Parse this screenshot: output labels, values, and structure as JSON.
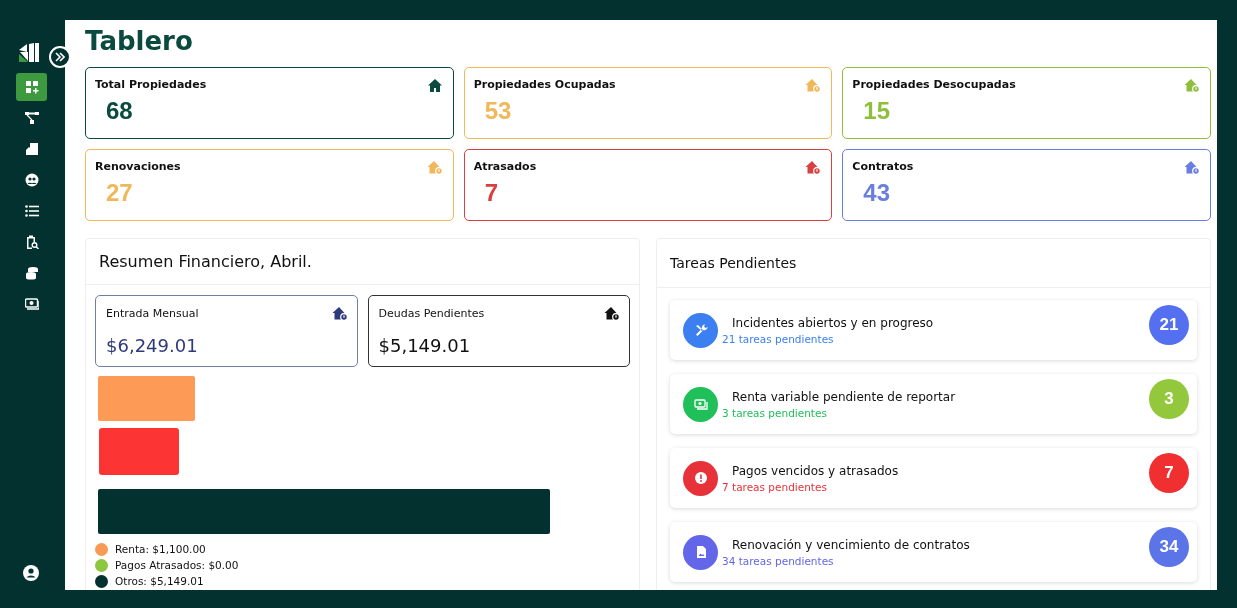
{
  "sidebar": {
    "items": [
      {
        "selected": true
      },
      {
        "selected": false
      },
      {
        "selected": false
      },
      {
        "selected": false
      },
      {
        "selected": false
      },
      {
        "selected": false
      },
      {
        "selected": false
      },
      {
        "selected": false
      }
    ]
  },
  "page_title": "Tablero",
  "stats": [
    {
      "label": "Total Propiedades",
      "value": "68",
      "color": "#0b4a3f",
      "kind": "house"
    },
    {
      "label": "Propiedades Ocupadas",
      "value": "53",
      "color": "#f0b85a",
      "kind": "house-badge"
    },
    {
      "label": "Propiedades Desocupadas",
      "value": "15",
      "color": "#8fbf3a",
      "kind": "house-badge"
    },
    {
      "label": "Renovaciones",
      "value": "27",
      "color": "#f0b85a",
      "kind": "house-badge"
    },
    {
      "label": "Atrasados",
      "value": "7",
      "color": "#d94040",
      "kind": "house-badge"
    },
    {
      "label": "Contratos",
      "value": "43",
      "color": "#6a7ee0",
      "kind": "house-badge"
    }
  ],
  "finance": {
    "title": "Resumen Financiero, Abril.",
    "cards": [
      {
        "label": "Entrada Mensual",
        "value": "$6,249.01",
        "color": "#2e3a7a"
      },
      {
        "label": "Deudas Pendientes",
        "value": "$5,149.01",
        "color": "#111111"
      }
    ],
    "legend": [
      {
        "label": "Renta: $1,100.00",
        "color": "#f89a55"
      },
      {
        "label": "Pagos Atrasados: $0.00",
        "color": "#8dc63f"
      },
      {
        "label": "Otros: $5,149.01",
        "color": "#02312f"
      }
    ]
  },
  "tasks": {
    "title": "Tareas Pendientes",
    "items": [
      {
        "title": "Incidentes abiertos y en progreso",
        "subtitle": "21 tareas pendientes",
        "color": "#3b7ff0",
        "badge": {
          "count": "21",
          "color": "#5470f0"
        }
      },
      {
        "title": "Renta variable pendiente de reportar",
        "subtitle": "3 tareas pendientes",
        "color": "#1fbf5a",
        "badge": {
          "count": "3",
          "color": "#94c83c"
        }
      },
      {
        "title": "Pagos vencidos y atrasados",
        "subtitle": "7 tareas pendientes",
        "color": "#e8323a",
        "badge": {
          "count": "7",
          "color": "#f03030"
        }
      },
      {
        "title": "Renovación y vencimiento de contratos",
        "subtitle": "34 tareas pendientes",
        "color": "#6366e8",
        "badge": {
          "count": "34",
          "color": "#5b74e8"
        }
      }
    ]
  }
}
